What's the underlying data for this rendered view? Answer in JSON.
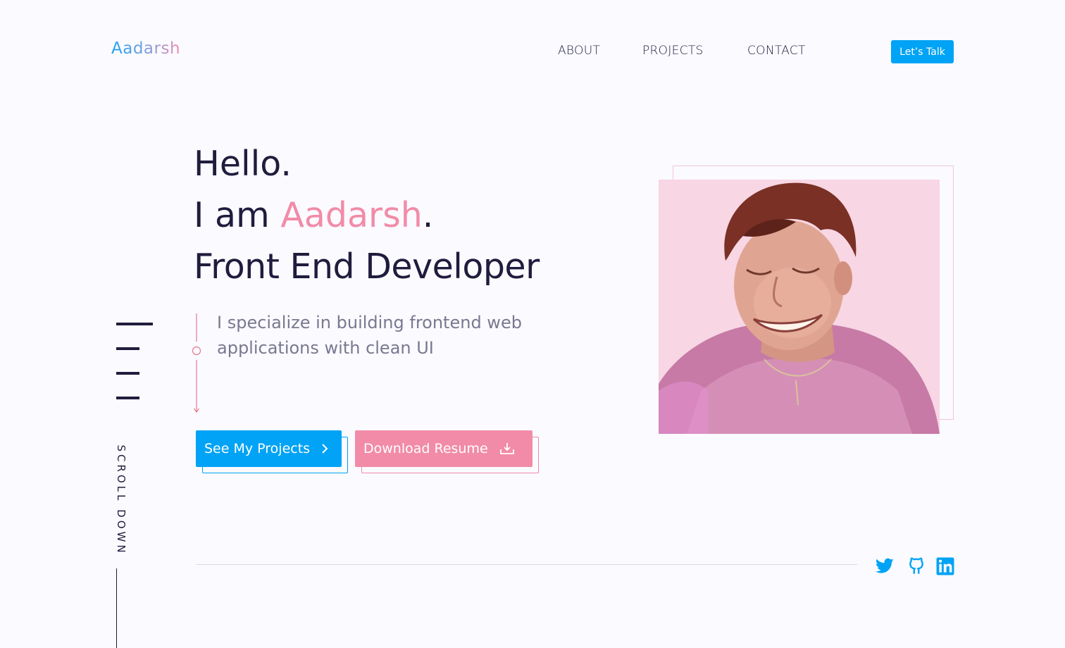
{
  "brand": {
    "logo_text": "Aadarsh"
  },
  "nav": {
    "about": "ABOUT",
    "projects": "PROJECTS",
    "contact": "CONTACT",
    "cta": "Let’s Talk"
  },
  "hero": {
    "greeting": "Hello.",
    "intro_prefix": "I am ",
    "name": "Aadarsh",
    "intro_suffix": ".",
    "role": "Front End Developer",
    "description": "I specialize in building frontend web applications with clean UI",
    "primary_button": "See My Projects",
    "secondary_button": "Download Resume"
  },
  "sidebar": {
    "scroll_label": "SCROLL DOWN"
  },
  "social": {
    "icons": [
      "twitter-icon",
      "github-icon",
      "linkedin-icon"
    ]
  },
  "colors": {
    "accent_blue": "#00a3f5",
    "accent_pink": "#f28ba8",
    "text_dark": "#1f1c3d",
    "text_muted": "#7a7890"
  }
}
